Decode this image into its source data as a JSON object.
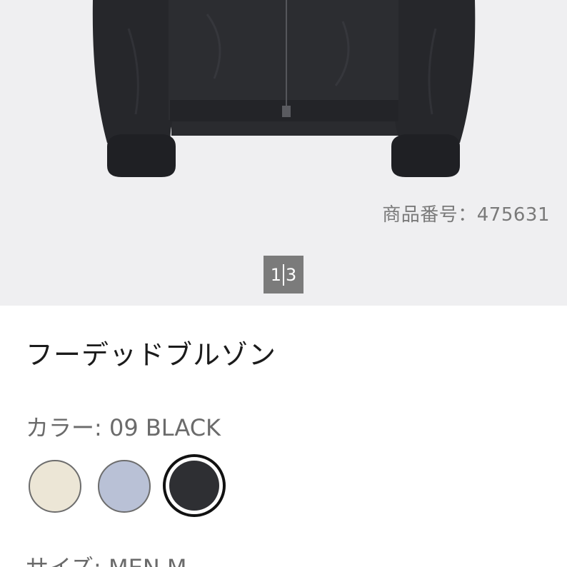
{
  "product": {
    "code_text": "商品番号：475631",
    "title": "フーデッドブルゾン"
  },
  "gallery": {
    "current": "1",
    "total": "3"
  },
  "color": {
    "label": "カラー: 09 BLACK",
    "options": [
      {
        "name": "natural",
        "hex": "#ece6d6",
        "selected": false
      },
      {
        "name": "blue",
        "hex": "#b9c1d6",
        "selected": false
      },
      {
        "name": "black",
        "hex": "#2e2f33",
        "selected": true
      }
    ]
  },
  "size": {
    "label": "サイズ: MEN M"
  },
  "colors": {
    "image_bg": "#efeff1",
    "jacket": "#2a2b2f",
    "pager_bg": "#7b7b7b"
  }
}
